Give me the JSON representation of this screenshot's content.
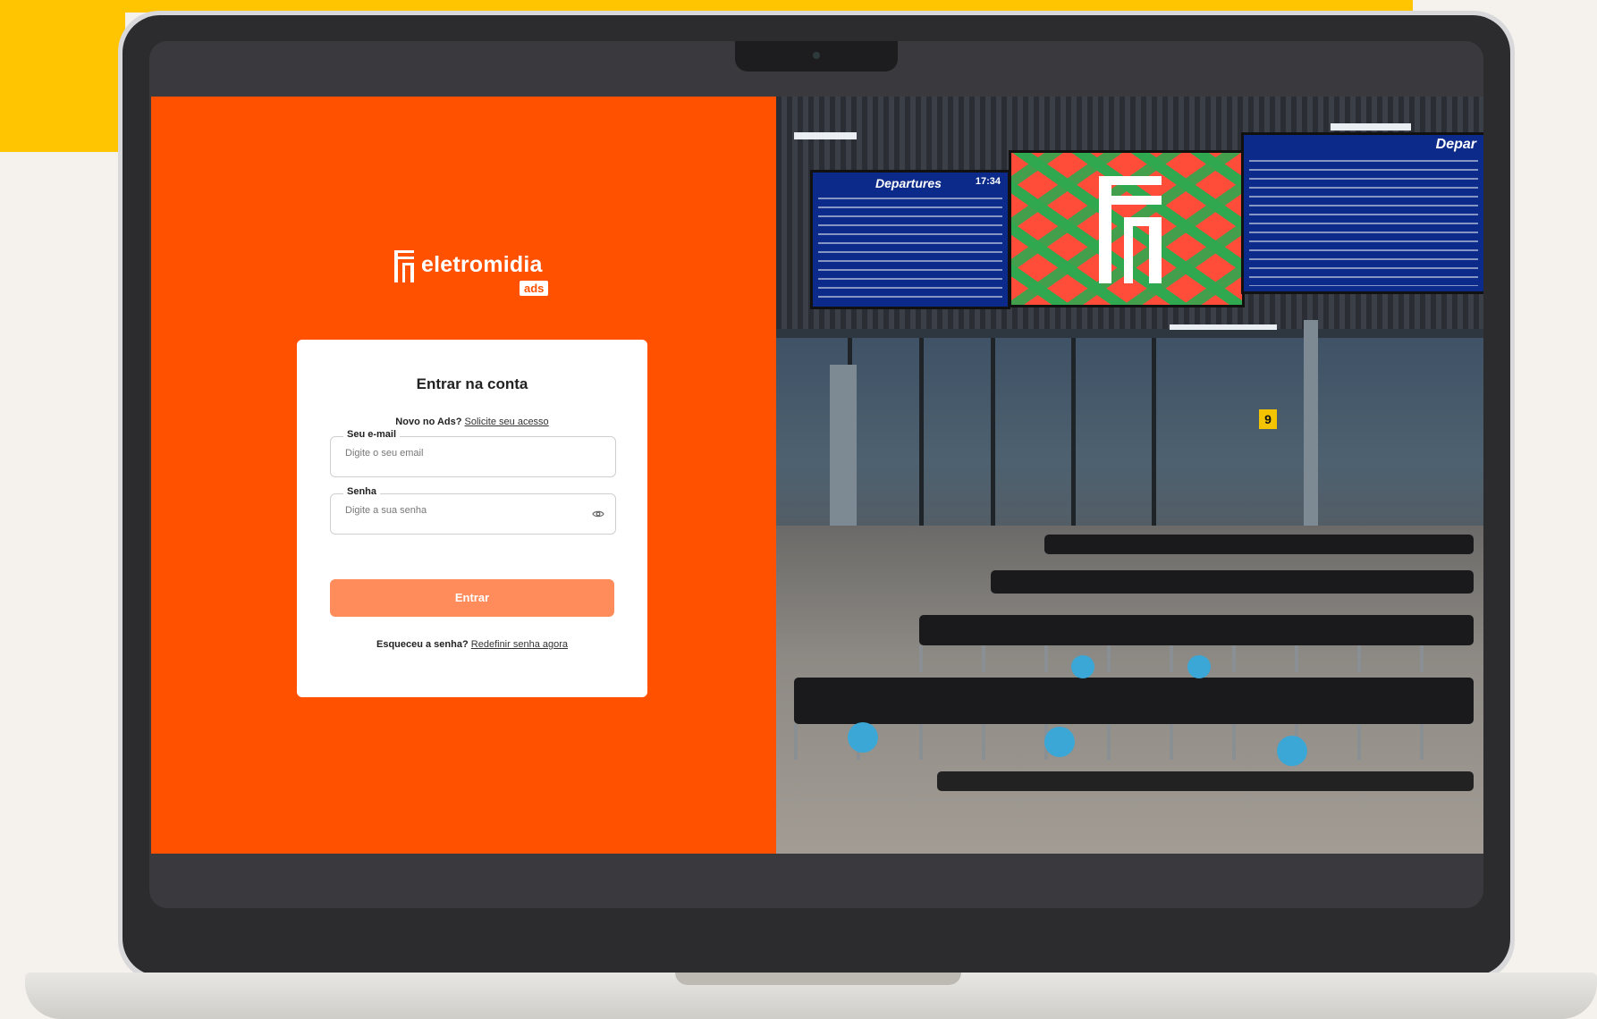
{
  "brand": {
    "wordmark": "eletromidia",
    "badge": "ads",
    "accent_color": "#ff5100"
  },
  "login": {
    "title": "Entrar na conta",
    "new_prompt": "Novo no Ads?",
    "request_access_link": "Solicite seu acesso",
    "email_label": "Seu e-mail",
    "email_placeholder": "Digite o seu email",
    "password_label": "Senha",
    "password_placeholder": "Digite a sua senha",
    "submit_label": "Entrar",
    "forgot_prompt": "Esqueceu a senha?",
    "reset_link": "Redefinir senha agora",
    "button_color": "#ff8c5a"
  },
  "scene": {
    "board_left_title": "Departures",
    "board_left_time": "17:34",
    "board_right_title": "Depar",
    "gate_number": "9",
    "icons": [
      "eye-icon",
      "eletromidia-logo-icon"
    ]
  }
}
